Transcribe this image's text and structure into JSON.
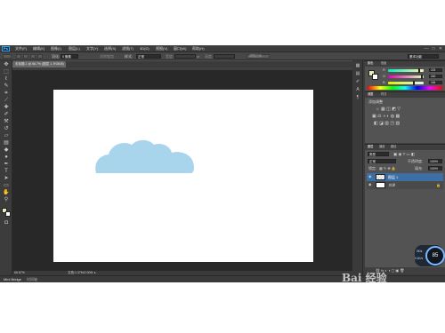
{
  "app": {
    "logo": "Ps"
  },
  "menubar": {
    "items": [
      "文件(F)",
      "编辑(E)",
      "图像(I)",
      "图层(L)",
      "文字(Y)",
      "选择(S)",
      "滤镜(T)",
      "3D(D)",
      "视图(V)",
      "窗口(W)",
      "帮助(H)"
    ],
    "window_controls": [
      "—",
      "□",
      "✕"
    ]
  },
  "options": {
    "feather_label": "羽化:",
    "feather_value": "0 像素",
    "antialias_label": "消除锯齿",
    "style_label": "样式:",
    "style_value": "正常",
    "width_label": "宽度:",
    "height_label": "高度:",
    "refine_button": "调整边缘...",
    "workspace": "基本功能"
  },
  "document": {
    "tab_title": "未标题-1 @ 66.7% (图层 1, RGB/8)"
  },
  "statusbar": {
    "zoom": "66.67%",
    "doc_info": "文档:1.37M/2.00M"
  },
  "minibridge": {
    "tabs": [
      "Mini Bridge",
      "时间轴"
    ]
  },
  "color_panel": {
    "tabs": [
      "颜色",
      "色板"
    ],
    "channels": [
      {
        "label": "R",
        "value": "223",
        "level": 0.875
      },
      {
        "label": "G",
        "value": "240",
        "level": 0.94
      },
      {
        "label": "B",
        "value": "184",
        "level": 0.72
      }
    ],
    "fg_color": "#dff0b8",
    "bg_color": "#ffffff"
  },
  "adjust_panel": {
    "tabs": [
      "调整",
      "样式"
    ],
    "title": "添加调整"
  },
  "layers_panel": {
    "tabs": [
      "图层",
      "通道",
      "路径"
    ],
    "kind_label": "类型",
    "blend_mode": "正常",
    "opacity_label": "不透明度:",
    "opacity_value": "100%",
    "lock_label": "锁定:",
    "fill_label": "填充:",
    "fill_value": "100%",
    "layers": [
      {
        "name": "图层 1",
        "selected": true
      },
      {
        "name": "背景",
        "selected": false
      }
    ]
  },
  "performance_widget": {
    "percent": "85",
    "upload": "0K/s",
    "download": "0.1K/s"
  },
  "cloud": {
    "color": "#a8d4ec"
  },
  "watermark": {
    "text": "Bai 经验",
    "url": "jingyan.baidu.com"
  }
}
